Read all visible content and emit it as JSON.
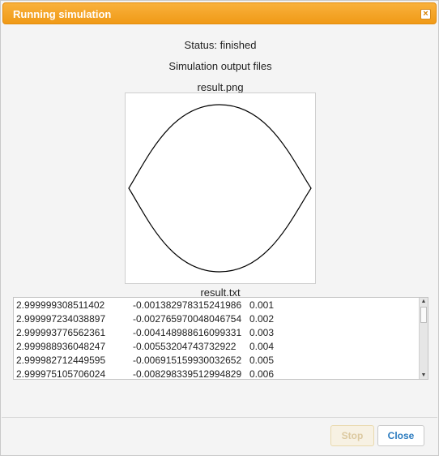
{
  "window": {
    "title": "Running simulation",
    "close_glyph": "×"
  },
  "status_text": "Status: finished",
  "output_heading": "Simulation output files",
  "files": {
    "image_name": "result.png",
    "text_name": "result.txt"
  },
  "result_rows": [
    [
      "2.999999308511402",
      "-0.001382978315241986",
      "0.001"
    ],
    [
      "2.999997234038897",
      "-0.002765970048046754",
      "0.002"
    ],
    [
      "2.999993776562361",
      "-0.004148988616099331",
      "0.003"
    ],
    [
      "2.999988936048247",
      "-0.00553204743732922",
      "0.004"
    ],
    [
      "2.999982712449595",
      "-0.006915159930032652",
      "0.005"
    ],
    [
      "2.999975105706024",
      "-0.008298339512994829",
      "0.006"
    ]
  ],
  "buttons": {
    "stop": "Stop",
    "close": "Close"
  },
  "colors": {
    "title_bar": "#f5a623",
    "close_text": "#2b7bbf"
  }
}
